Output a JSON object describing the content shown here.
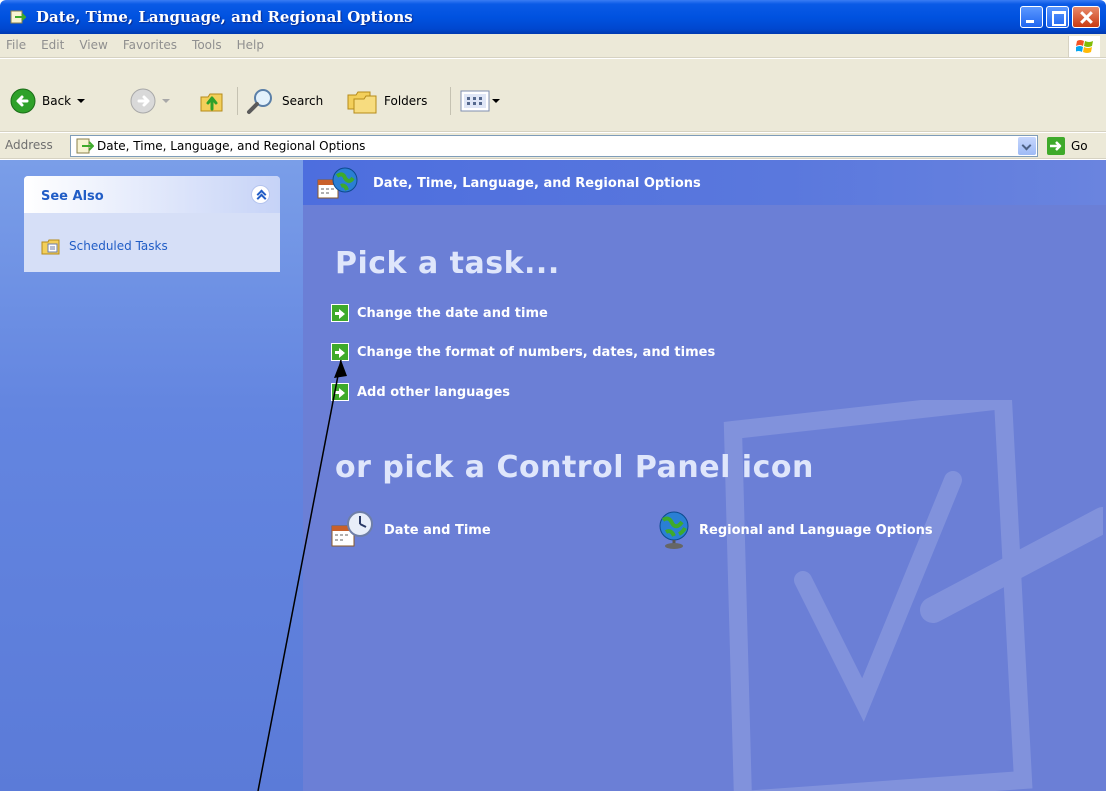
{
  "window": {
    "title": "Date, Time, Language, and Regional Options"
  },
  "menu": [
    "File",
    "Edit",
    "View",
    "Favorites",
    "Tools",
    "Help"
  ],
  "toolbar": {
    "back_label": "Back",
    "search_label": "Search",
    "folders_label": "Folders"
  },
  "address": {
    "label": "Address",
    "value": "Date, Time, Language, and Regional Options",
    "go_label": "Go"
  },
  "see_also": {
    "heading": "See Also",
    "items": [
      "Scheduled Tasks"
    ]
  },
  "main": {
    "header": "Date, Time, Language, and Regional Options",
    "pick_task_title": "Pick a task...",
    "tasks": [
      "Change the date and time",
      "Change the format of numbers, dates, and times",
      "Add other languages"
    ],
    "pick_icon_title": "or pick a Control Panel icon",
    "icons": [
      "Date and Time",
      "Regional and Language Options"
    ]
  },
  "colors": {
    "titlebar": "#0052e0",
    "main_background": "#6b7fd6",
    "link_blue": "#215dc6",
    "task_arrow_green": "#3eaa2b"
  }
}
